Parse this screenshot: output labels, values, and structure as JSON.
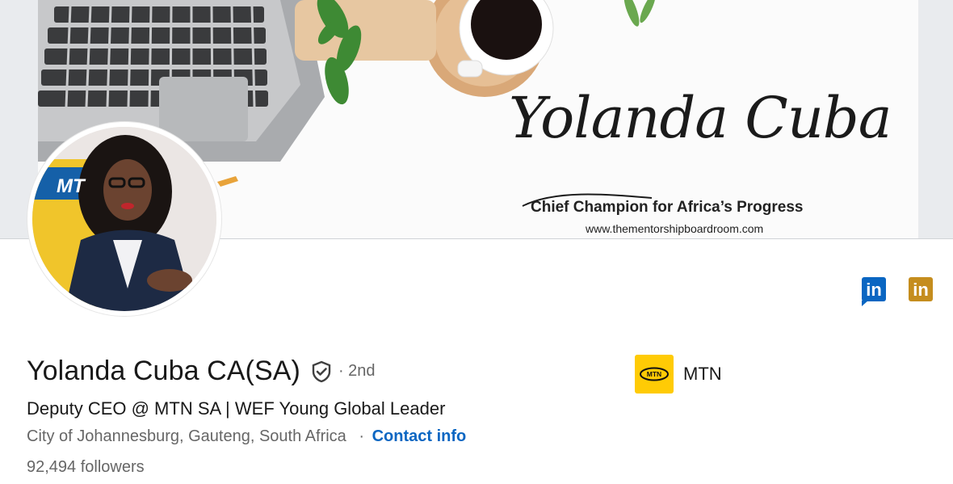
{
  "cover": {
    "signature": "Yolanda Cuba",
    "tagline": "Chief Champion for Africa’s Progress",
    "url": "www.thementorshipboardroom.com"
  },
  "avatar": {
    "sign_text": "MT"
  },
  "profile": {
    "name": "Yolanda Cuba CA(SA)",
    "degree": "· 2nd",
    "headline": "Deputy CEO @ MTN SA | WEF Young Global Leader",
    "location": "City of Johannesburg, Gauteng, South Africa",
    "location_separator": "·",
    "contact_label": "Contact info",
    "followers": "92,494 followers"
  },
  "company": {
    "name": "MTN",
    "logo_text": "MTN",
    "logo_color": "#ffcb05"
  },
  "icons": {
    "linkedin_blue": {
      "label": "in",
      "color": "#0a66c2"
    },
    "linkedin_gold": {
      "label": "in",
      "color": "#c58d1e"
    }
  }
}
